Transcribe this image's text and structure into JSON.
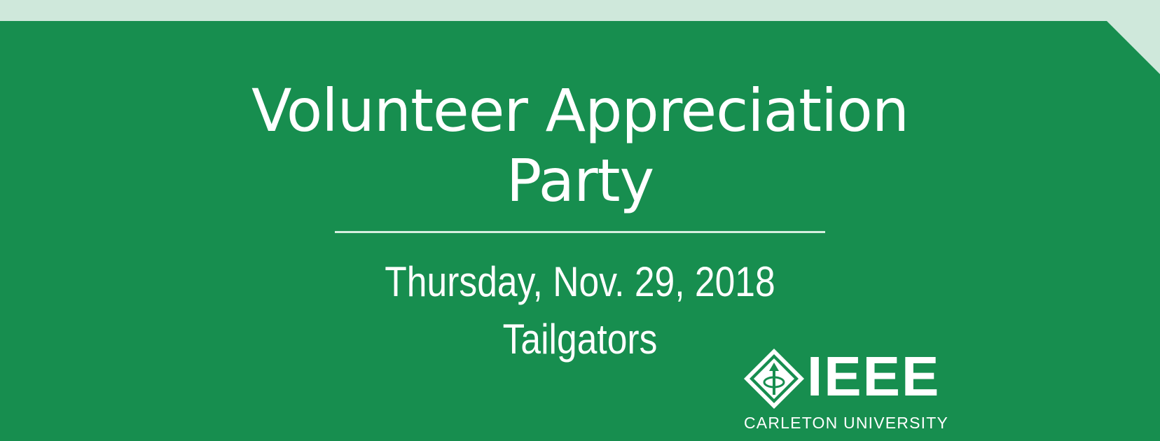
{
  "banner": {
    "title_line_1": "Volunteer Appreciation",
    "title_line_2": "Party",
    "date": "Thursday, Nov. 29, 2018",
    "venue": "Tailgators"
  },
  "logo": {
    "wordmark": "IEEE",
    "subtitle": "CARLETON UNIVERSITY",
    "icon": "ieee-diamond-icon"
  },
  "colors": {
    "banner_green": "#178e4f",
    "light_band": "#cfe8db",
    "text": "#ffffff",
    "divider": "#d6efe0"
  }
}
